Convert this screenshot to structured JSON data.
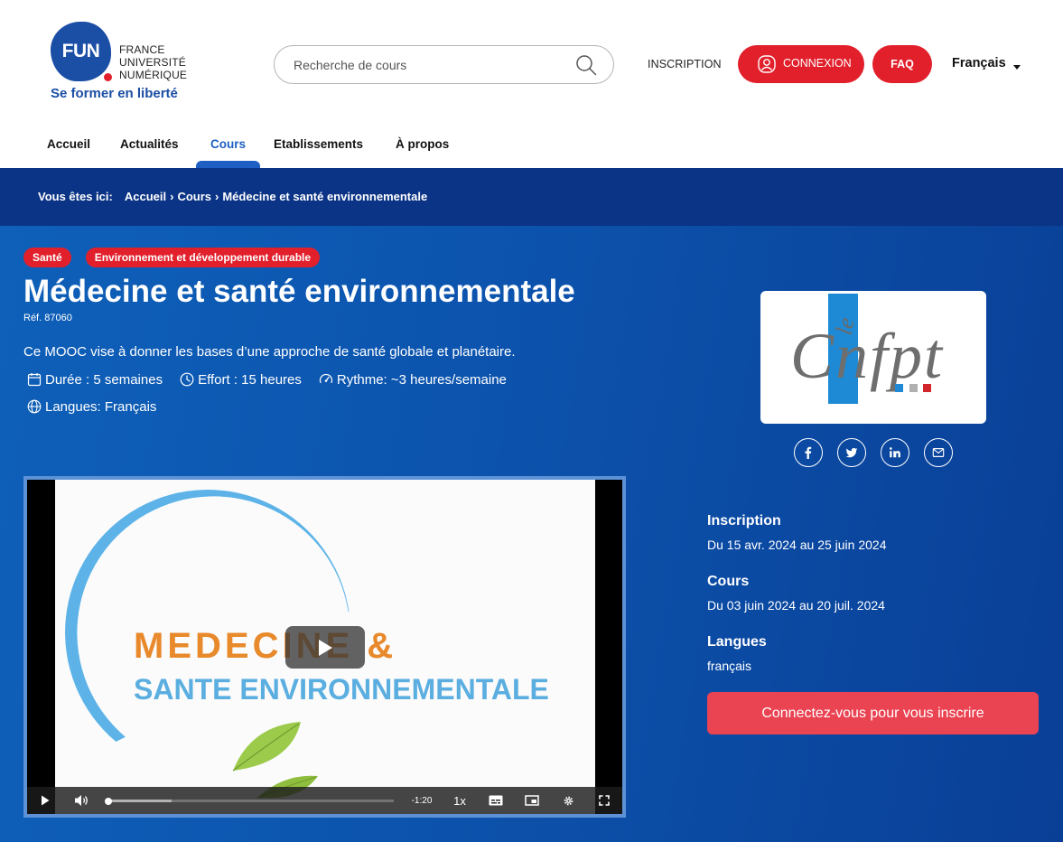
{
  "header": {
    "logo": {
      "acronym": "FUN",
      "line1": "FRANCE",
      "line2": "UNIVERSITÉ",
      "line3": "NUMÉRIQUE",
      "tagline": "Se former en liberté"
    },
    "search": {
      "placeholder": "Recherche de cours",
      "value": "",
      "icon": "search-icon"
    },
    "inscription_label": "INSCRIPTION",
    "connexion_label": "CONNEXION",
    "faq_label": "FAQ",
    "language": "Français"
  },
  "nav": {
    "items": [
      {
        "label": "Accueil",
        "active": false
      },
      {
        "label": "Actualités",
        "active": false
      },
      {
        "label": "Cours",
        "active": true
      },
      {
        "label": "Etablissements",
        "active": false
      },
      {
        "label": "À propos",
        "active": false
      }
    ]
  },
  "breadcrumb": {
    "prefix": "Vous êtes ici:",
    "separator": "›",
    "items": [
      "Accueil",
      "Cours",
      "Médecine et santé environnementale"
    ]
  },
  "course": {
    "tags": [
      "Santé",
      "Environnement et développement durable"
    ],
    "title": "Médecine et santé environnementale",
    "reference": "Réf. 87060",
    "description": "Ce MOOC vise à donner les bases d’une approche de santé globale et planétaire.",
    "meta": {
      "duration": "Durée : 5 semaines",
      "effort": "Effort : 15 heures",
      "rhythm": "Rythme: ~3 heures/semaine",
      "languages": "Langues: Français"
    },
    "partner_logo": {
      "small": "le",
      "wordmark": "Cnfpt"
    },
    "share": [
      "facebook-icon",
      "twitter-icon",
      "linkedin-icon",
      "mail-icon"
    ]
  },
  "video": {
    "title_line1": "MEDECINE &",
    "title_line2": "SANTE ENVIRONNEMENTALE",
    "time_remaining": "-1:20",
    "playback_rate": "1x",
    "played": 0,
    "buffered": 0.22
  },
  "sessions": {
    "inscription": {
      "label": "Inscription",
      "value": "Du 15 avr. 2024 au 25 juin 2024"
    },
    "cours": {
      "label": "Cours",
      "value": "Du 03 juin 2024 au 20 juil. 2024"
    },
    "langues": {
      "label": "Langues",
      "value": "français"
    },
    "cta_label": "Connectez-vous pour vous inscrire"
  },
  "colors": {
    "brand_blue": "#1b4ea5",
    "accent_red": "#e2202c",
    "nav_active": "#1f5fc3",
    "breadcrumb_bg": "#0b3486",
    "cta": "#ea4352",
    "video_orange": "#e8892b",
    "video_blue": "#5aaee0"
  }
}
